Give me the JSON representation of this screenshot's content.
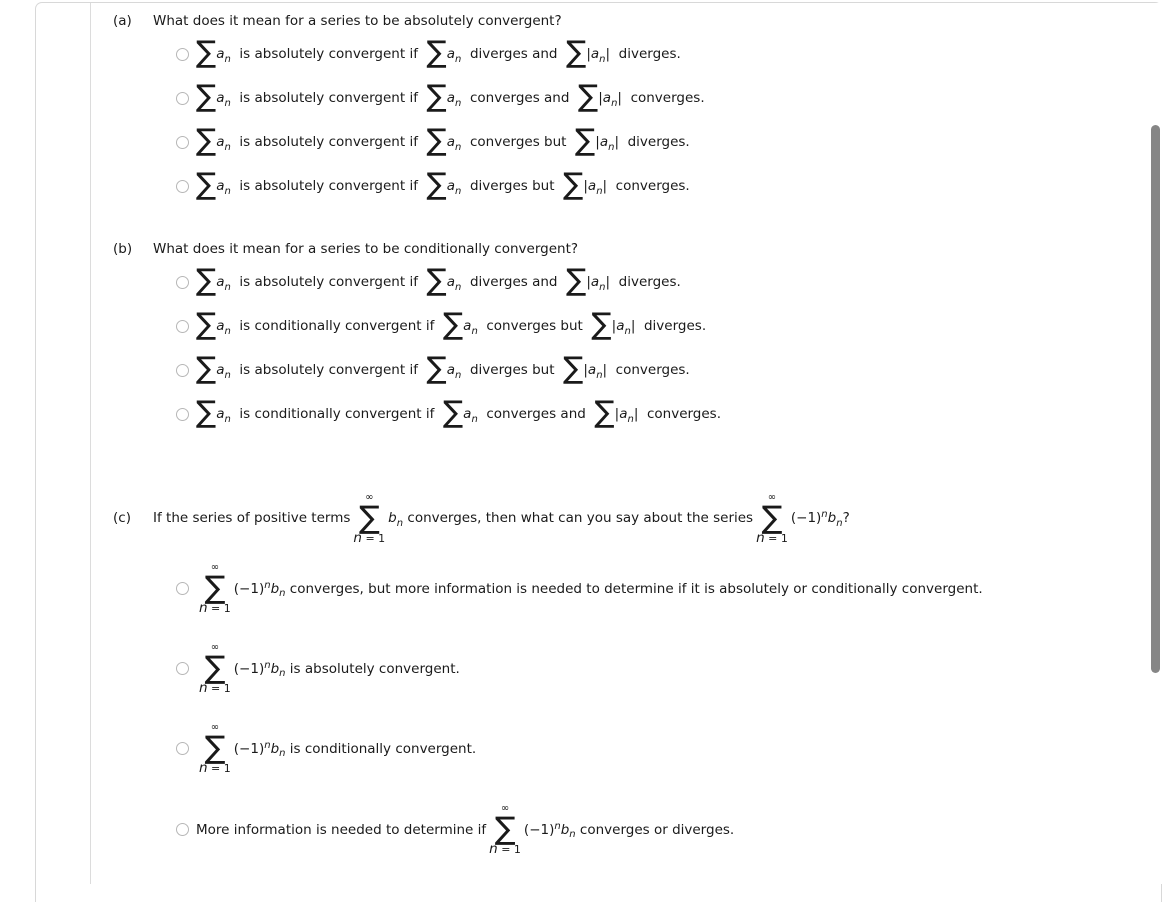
{
  "document": {
    "type": "online-homework-question",
    "scrollbar": {
      "thumb_color": "#868686",
      "position": "upper-middle"
    }
  },
  "parts": [
    {
      "label": "(a)",
      "question": "What does it mean for a series to be absolutely convergent?",
      "choices": [
        {
          "id": "a1",
          "selected": false,
          "segments": [
            {
              "kind": "sum",
              "body": "a",
              "sub": "n"
            },
            {
              "kind": "text",
              "text": "is absolutely convergent if"
            },
            {
              "kind": "sum",
              "body": "a",
              "sub": "n"
            },
            {
              "kind": "text",
              "text": "diverges and"
            },
            {
              "kind": "sum-abs",
              "body": "a",
              "sub": "n"
            },
            {
              "kind": "text",
              "text": "diverges."
            }
          ]
        },
        {
          "id": "a2",
          "selected": false,
          "segments": [
            {
              "kind": "sum",
              "body": "a",
              "sub": "n"
            },
            {
              "kind": "text",
              "text": "is absolutely convergent if"
            },
            {
              "kind": "sum",
              "body": "a",
              "sub": "n"
            },
            {
              "kind": "text",
              "text": "converges and"
            },
            {
              "kind": "sum-abs",
              "body": "a",
              "sub": "n"
            },
            {
              "kind": "text",
              "text": "converges."
            }
          ]
        },
        {
          "id": "a3",
          "selected": false,
          "segments": [
            {
              "kind": "sum",
              "body": "a",
              "sub": "n"
            },
            {
              "kind": "text",
              "text": "is absolutely convergent if"
            },
            {
              "kind": "sum",
              "body": "a",
              "sub": "n"
            },
            {
              "kind": "text",
              "text": "converges but"
            },
            {
              "kind": "sum-abs",
              "body": "a",
              "sub": "n"
            },
            {
              "kind": "text",
              "text": "diverges."
            }
          ]
        },
        {
          "id": "a4",
          "selected": false,
          "segments": [
            {
              "kind": "sum",
              "body": "a",
              "sub": "n"
            },
            {
              "kind": "text",
              "text": "is absolutely convergent if"
            },
            {
              "kind": "sum",
              "body": "a",
              "sub": "n"
            },
            {
              "kind": "text",
              "text": "diverges but"
            },
            {
              "kind": "sum-abs",
              "body": "a",
              "sub": "n"
            },
            {
              "kind": "text",
              "text": "converges."
            }
          ]
        }
      ]
    },
    {
      "label": "(b)",
      "question": "What does it mean for a series to be conditionally convergent?",
      "choices": [
        {
          "id": "b1",
          "selected": false,
          "segments": [
            {
              "kind": "sum",
              "body": "a",
              "sub": "n"
            },
            {
              "kind": "text",
              "text": "is absolutely convergent if"
            },
            {
              "kind": "sum",
              "body": "a",
              "sub": "n"
            },
            {
              "kind": "text",
              "text": "diverges and"
            },
            {
              "kind": "sum-abs",
              "body": "a",
              "sub": "n"
            },
            {
              "kind": "text",
              "text": "diverges."
            }
          ]
        },
        {
          "id": "b2",
          "selected": false,
          "segments": [
            {
              "kind": "sum",
              "body": "a",
              "sub": "n"
            },
            {
              "kind": "text",
              "text": "is conditionally convergent if"
            },
            {
              "kind": "sum",
              "body": "a",
              "sub": "n"
            },
            {
              "kind": "text",
              "text": "converges but"
            },
            {
              "kind": "sum-abs",
              "body": "a",
              "sub": "n"
            },
            {
              "kind": "text",
              "text": "diverges."
            }
          ]
        },
        {
          "id": "b3",
          "selected": false,
          "segments": [
            {
              "kind": "sum",
              "body": "a",
              "sub": "n"
            },
            {
              "kind": "text",
              "text": "is absolutely convergent if"
            },
            {
              "kind": "sum",
              "body": "a",
              "sub": "n"
            },
            {
              "kind": "text",
              "text": "diverges but"
            },
            {
              "kind": "sum-abs",
              "body": "a",
              "sub": "n"
            },
            {
              "kind": "text",
              "text": "converges."
            }
          ]
        },
        {
          "id": "b4",
          "selected": false,
          "segments": [
            {
              "kind": "sum",
              "body": "a",
              "sub": "n"
            },
            {
              "kind": "text",
              "text": "is conditionally convergent if"
            },
            {
              "kind": "sum",
              "body": "a",
              "sub": "n"
            },
            {
              "kind": "text",
              "text": "converges and"
            },
            {
              "kind": "sum-abs",
              "body": "a",
              "sub": "n"
            },
            {
              "kind": "text",
              "text": "converges."
            }
          ]
        }
      ]
    },
    {
      "label": "(c)",
      "question_parts": {
        "lead": "If the series of positive terms",
        "middle": "converges, then what can you say about the series",
        "trail": "?"
      },
      "sum_limits": {
        "top": "∞",
        "bottom": "n = 1"
      },
      "choices": [
        {
          "id": "c1",
          "selected": false,
          "text": "converges, but more information is needed to determine if it is absolutely or conditionally convergent."
        },
        {
          "id": "c2",
          "selected": false,
          "text": "is absolutely convergent."
        },
        {
          "id": "c3",
          "selected": false,
          "text": "is conditionally convergent."
        },
        {
          "id": "c4",
          "selected": false,
          "lead": "More information is needed to determine if",
          "trail": "converges or diverges."
        }
      ]
    }
  ],
  "symbols": {
    "sum": "∑",
    "infinity": "∞",
    "lower_limit": "n = 1",
    "b_term": "b",
    "a_term": "a",
    "index": "n",
    "alternating": "(−1)"
  }
}
